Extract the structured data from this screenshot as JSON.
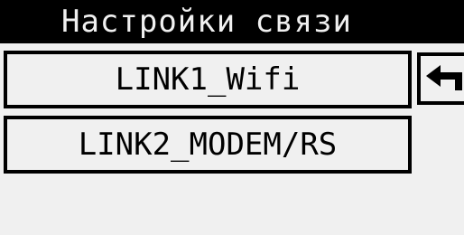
{
  "header": {
    "title": "Настройки связи"
  },
  "menu": {
    "items": [
      {
        "label": "LINK1_Wifi"
      },
      {
        "label": "LINK2_MODEM/RS"
      }
    ]
  },
  "navigation": {
    "back_icon": "back-arrow-icon"
  },
  "colors": {
    "background": "#f0f0f0",
    "foreground": "#000000"
  }
}
